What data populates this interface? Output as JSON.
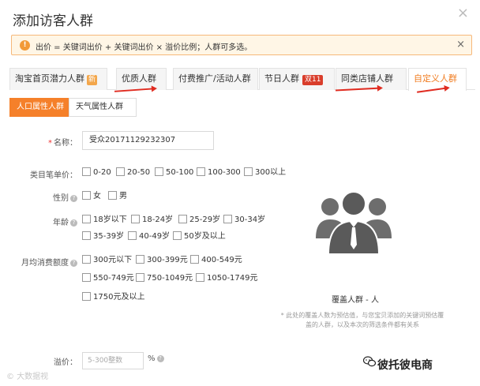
{
  "dialog": {
    "title": "添加访客人群",
    "close": "×"
  },
  "notice": {
    "icon": "!",
    "text": "出价 = 关键词出价 + 关键词出价 × 溢价比例；人群可多选。",
    "close": "×"
  },
  "tabs": [
    {
      "label": "淘宝首页潜力人群",
      "badge": "新"
    },
    {
      "label": "优质人群"
    },
    {
      "label": "付费推广/活动人群"
    },
    {
      "label": "节日人群",
      "badge": "双11"
    },
    {
      "label": "同类店铺人群"
    },
    {
      "label": "自定义人群"
    }
  ],
  "subtabs": [
    {
      "label": "人口属性人群"
    },
    {
      "label": "天气属性人群"
    }
  ],
  "form": {
    "name_label": "名称：",
    "name_required": "*",
    "name_value": "受众20171129232307",
    "category_label": "类目笔单价：",
    "category_options": [
      "0-20",
      "20-50",
      "50-100",
      "100-300",
      "300以上"
    ],
    "gender_label": "性别",
    "gender_options": [
      "女",
      "男"
    ],
    "age_label": "年龄",
    "age_options": [
      "18岁以下",
      "18-24岁",
      "25-29岁",
      "30-34岁",
      "35-39岁",
      "40-49岁",
      "50岁及以上"
    ],
    "spend_label": "月均消费额度",
    "spend_options": [
      "300元以下",
      "300-399元",
      "400-549元",
      "550-749元",
      "750-1049元",
      "1050-1749元",
      "1750元及以上"
    ],
    "premium_label": "溢价：",
    "premium_placeholder": "5-300整数",
    "premium_unit": "%",
    "help": "?"
  },
  "coverage": {
    "text": "覆盖人群 - 人",
    "note": "* 此处的覆盖人数为预估值，与您宝贝添加的关键词预估覆盖的人群，以及本次的筛选条件都有关系"
  },
  "watermarks": {
    "left": "© 大数据视",
    "right": "彼托彼电商"
  },
  "colors": {
    "accent": "#f5802a",
    "arrow": "#e02b20",
    "notice_bg": "#fff6e6"
  }
}
